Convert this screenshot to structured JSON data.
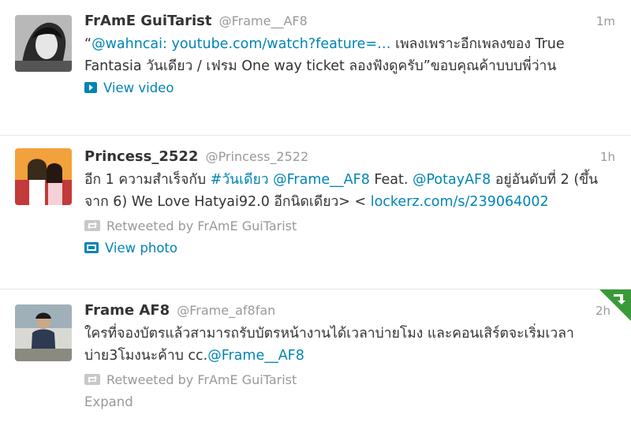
{
  "tweets": [
    {
      "fullname": "FrAmE GuiTarist",
      "username": "@Frame__AF8",
      "time": "1m",
      "text_open_quote": "“",
      "text_link": "@wahncai: youtube.com/watch?feature=…",
      "text_rest": " เพลงเพราะอีกเพลงของ True Fantasia วันเดียว / เฟรม One way ticket ลองฟังดูครับ”ขอบคุณค้าบบบพี่ว่าน",
      "action": "View video"
    },
    {
      "fullname": "Princess_2522",
      "username": "@Princess_2522",
      "time": "1h",
      "text_a": "อีก 1 ความสำเร็จกับ ",
      "hashtag": "#วันเดียว",
      "text_b": " ",
      "mention1": "@Frame__AF8",
      "text_c": " Feat. ",
      "mention2": "@PotayAF8",
      "text_d": " อยู่อันดับที่ 2 (ขึ้นจาก 6) We Love Hatyai92.0 อีกนิดเดียว> < ",
      "link": "lockerz.com/s/239064002",
      "retweeted_by": "Retweeted by FrAmE GuiTarist",
      "action": "View photo"
    },
    {
      "fullname": "Frame AF8",
      "username": "@Frame_af8fan",
      "time": "2h",
      "text_a": "ใครที่จองบัตรแล้วสามารถรับบัตรหน้างานได้เวลาบ่ายโมง และคอนเสิร์ตจะเริ่มเวลาบ่าย3โมงนะค้าบ cc.",
      "mention": "@Frame__AF8",
      "retweeted_by": "Retweeted by FrAmE GuiTarist",
      "action": "Expand"
    }
  ],
  "colors": {
    "link": "#0084b4",
    "muted": "#999999",
    "corner": "#3a9a3a"
  }
}
